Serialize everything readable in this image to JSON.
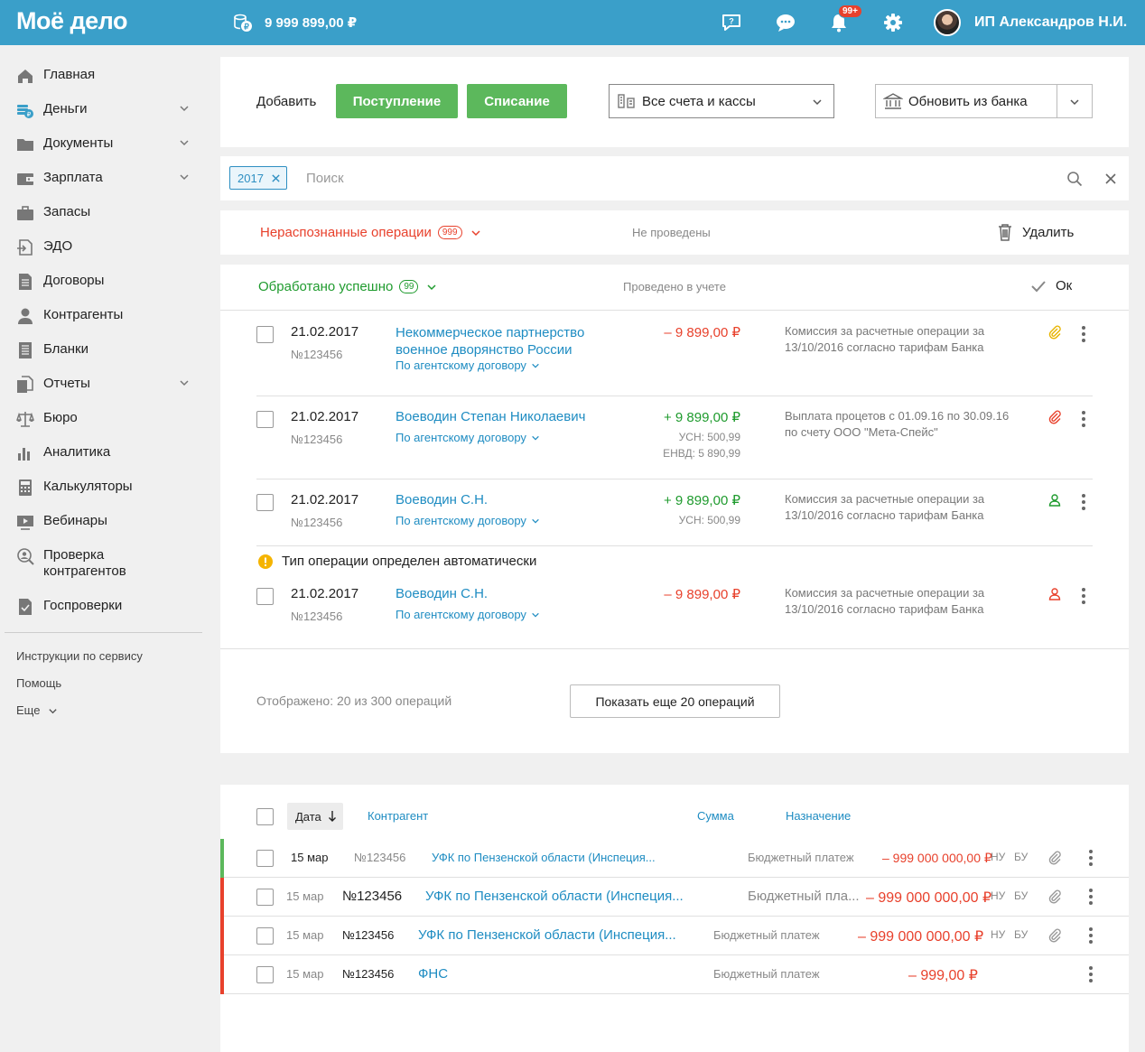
{
  "header": {
    "logo": "Моё дело",
    "balance": "9 999 899,00 ₽",
    "notifications_badge": "99+",
    "user_name": "ИП Александров Н.И.",
    "accent": "#3a9fc9"
  },
  "sidebar": {
    "items": [
      {
        "label": "Главная",
        "icon": "home-icon",
        "chevron": false
      },
      {
        "label": "Деньги",
        "icon": "money-icon",
        "chevron": true
      },
      {
        "label": "Документы",
        "icon": "folder-icon",
        "chevron": true
      },
      {
        "label": "Зарплата",
        "icon": "wallet-icon",
        "chevron": true
      },
      {
        "label": "Запасы",
        "icon": "briefcase-icon",
        "chevron": false
      },
      {
        "label": "ЭДО",
        "icon": "edo-icon",
        "chevron": false
      },
      {
        "label": "Договоры",
        "icon": "document-icon",
        "chevron": false
      },
      {
        "label": "Контрагенты",
        "icon": "person-icon",
        "chevron": false
      },
      {
        "label": "Бланки",
        "icon": "forms-icon",
        "chevron": false
      },
      {
        "label": "Отчеты",
        "icon": "reports-icon",
        "chevron": true
      },
      {
        "label": "Бюро",
        "icon": "scales-icon",
        "chevron": false
      },
      {
        "label": "Аналитика",
        "icon": "analytics-icon",
        "chevron": false
      },
      {
        "label": "Калькуляторы",
        "icon": "calculator-icon",
        "chevron": false
      },
      {
        "label": "Вебинары",
        "icon": "video-icon",
        "chevron": false
      },
      {
        "label": "Проверка контрагентов",
        "icon": "search-person-icon",
        "chevron": false
      },
      {
        "label": "Госпроверки",
        "icon": "inspection-icon",
        "chevron": false
      }
    ],
    "footer_links": [
      "Инструкции по сервису",
      "Помощь",
      "Еще"
    ]
  },
  "toolbar": {
    "add_label": "Добавить",
    "income_label": "Поступление",
    "expense_label": "Списание",
    "accounts_select": "Все счета и кассы",
    "refresh_label": "Обновить из банка"
  },
  "search": {
    "tag": "2017",
    "placeholder": "Поиск"
  },
  "unrecognized": {
    "title": "Нераспознанные операции",
    "count": "999",
    "status": "Не проведены",
    "delete_label": "Удалить"
  },
  "processed": {
    "title": "Обработано успешно",
    "count": "99",
    "status": "Проведено в учете",
    "ok_label": "Ок",
    "auto_notice": "Тип операции определен автоматически",
    "operations": [
      {
        "date": "21.02.2017",
        "number": "№123456",
        "counterparty": "Некоммерческое партнерство военное дворянство России",
        "contract": "По агентскому договору",
        "amount": "– 9 899,00 ₽",
        "sign": "minus",
        "taxes": [],
        "description": "Комиссия за расчетные операции за 13/10/2016 согласно тарифам Банка",
        "icon": "paperclip-icon",
        "icon_color": "#e8b400"
      },
      {
        "date": "21.02.2017",
        "number": "№123456",
        "counterparty": "Воеводин Степан Николаевич",
        "contract": "По агентскому договору",
        "amount": "+ 9 899,00 ₽",
        "sign": "plus",
        "taxes": [
          "УСН: 500,99",
          "ЕНВД: 5 890,99"
        ],
        "description": "Выплата процетов с 01.09.16 по 30.09.16 по счету ООО \"Мета-Спейс\"",
        "icon": "paperclip-icon",
        "icon_color": "#e8412c"
      },
      {
        "date": "21.02.2017",
        "number": "№123456",
        "counterparty": "Воеводин С.Н.",
        "contract": "По агентскому договору",
        "amount": "+ 9 899,00 ₽",
        "sign": "plus",
        "taxes": [
          "УСН: 500,99"
        ],
        "description": "Комиссия за расчетные операции за 13/10/2016 согласно тарифам Банка",
        "icon": "person-icon",
        "icon_color": "#1f9b2e"
      },
      {
        "date": "21.02.2017",
        "number": "№123456",
        "counterparty": "Воеводин С.Н.",
        "contract": "По агентскому договору",
        "amount": "– 9 899,00 ₽",
        "sign": "minus",
        "taxes": [],
        "description": "Комиссия за расчетные операции за 13/10/2016 согласно тарифам Банка",
        "icon": "person-icon",
        "icon_color": "#e8412c"
      }
    ],
    "shown_text": "Отображено: 20 из 300 операций",
    "show_more": "Показать еще 20 операций"
  },
  "table": {
    "columns": {
      "date": "Дата",
      "counterparty": "Контрагент",
      "amount": "Сумма",
      "purpose": "Назначение"
    },
    "rows": [
      {
        "date": "15 мар",
        "number": "№123456",
        "counterparty": "УФК по Пензенской области (Инспеция...",
        "purpose": "Бюджетный платеж",
        "amount": "– 999 000 000,00 ₽",
        "nu": "НУ",
        "bu": "БУ",
        "stripe": "#5cb85c",
        "attach": true
      },
      {
        "date": "15 мар",
        "number": "№123456",
        "counterparty": "УФК по Пензенской области (Инспеция...",
        "purpose": "Бюджетный пла...",
        "amount": "– 999 000 000,00 ₽",
        "nu": "НУ",
        "bu": "БУ",
        "stripe": "#e8412c",
        "attach": true
      },
      {
        "date": "15 мар",
        "number": "№123456",
        "counterparty": "УФК по Пензенской области (Инспеция...",
        "purpose": "Бюджетный платеж",
        "amount": "– 999 000 000,00 ₽",
        "nu": "НУ",
        "bu": "БУ",
        "stripe": "#e8412c",
        "attach": true
      },
      {
        "date": "15 мар",
        "number": "№123456",
        "counterparty": "ФНС",
        "purpose": "Бюджетный платеж",
        "amount": "– 999,00 ₽",
        "nu": "",
        "bu": "",
        "stripe": "#e8412c",
        "attach": false
      }
    ]
  }
}
